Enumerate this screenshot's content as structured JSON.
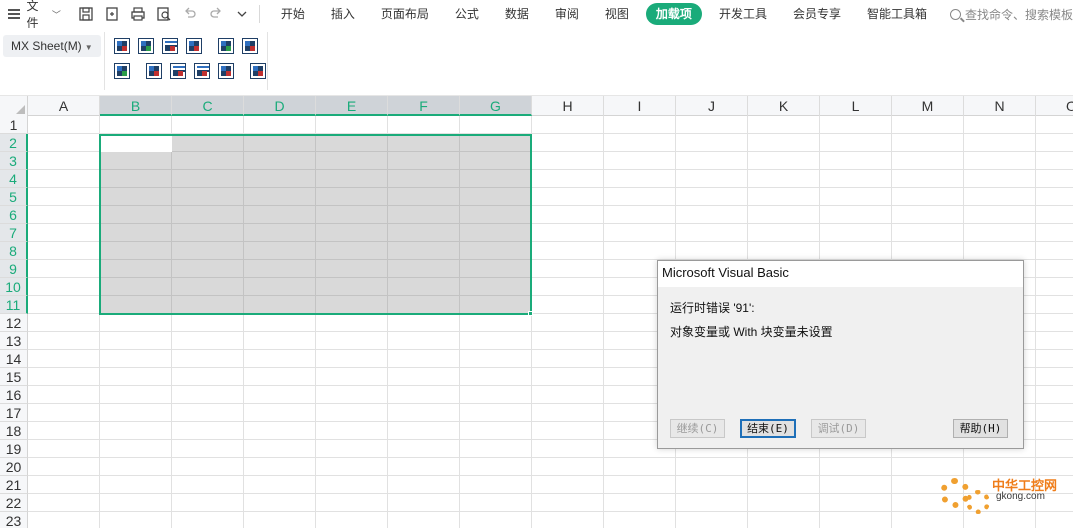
{
  "menubar": {
    "file_label": "文件",
    "tabs": [
      "开始",
      "插入",
      "页面布局",
      "公式",
      "数据",
      "审阅",
      "视图",
      "加载项",
      "开发工具",
      "会员专享",
      "智能工具箱"
    ],
    "active_tab": "加载项",
    "search_placeholder": "查找命令、搜索模板"
  },
  "ribbon": {
    "mx_sheet_label": "MX Sheet(M)"
  },
  "grid": {
    "columns": [
      "A",
      "B",
      "C",
      "D",
      "E",
      "F",
      "G",
      "H",
      "I",
      "J",
      "K",
      "L",
      "M",
      "N",
      "O"
    ],
    "selected_columns": [
      "B",
      "C",
      "D",
      "E",
      "F",
      "G"
    ],
    "rows": [
      "1",
      "2",
      "3",
      "4",
      "5",
      "6",
      "7",
      "8",
      "9",
      "10",
      "11",
      "12",
      "13",
      "14",
      "15",
      "16",
      "17",
      "18",
      "19",
      "20",
      "21",
      "22",
      "23"
    ],
    "selected_rows": [
      "2",
      "3",
      "4",
      "5",
      "6",
      "7",
      "8",
      "9",
      "10",
      "11"
    ],
    "selection_range": "B2:G11"
  },
  "dialog": {
    "title": "Microsoft Visual Basic",
    "message_line1": "运行时错误 '91':",
    "message_line2": "对象变量或 With 块变量未设置",
    "continue_label": "继续(C)",
    "end_label": "结束(E)",
    "debug_label": "调试(D)",
    "help_label": "帮助(H)"
  },
  "watermark": {
    "title": "中华工控网",
    "url": "gkong.com"
  },
  "colors": {
    "accent": "#1aab7a",
    "selection_fill": "#d9d9d9",
    "dialog_bg": "#f0f0f0"
  }
}
